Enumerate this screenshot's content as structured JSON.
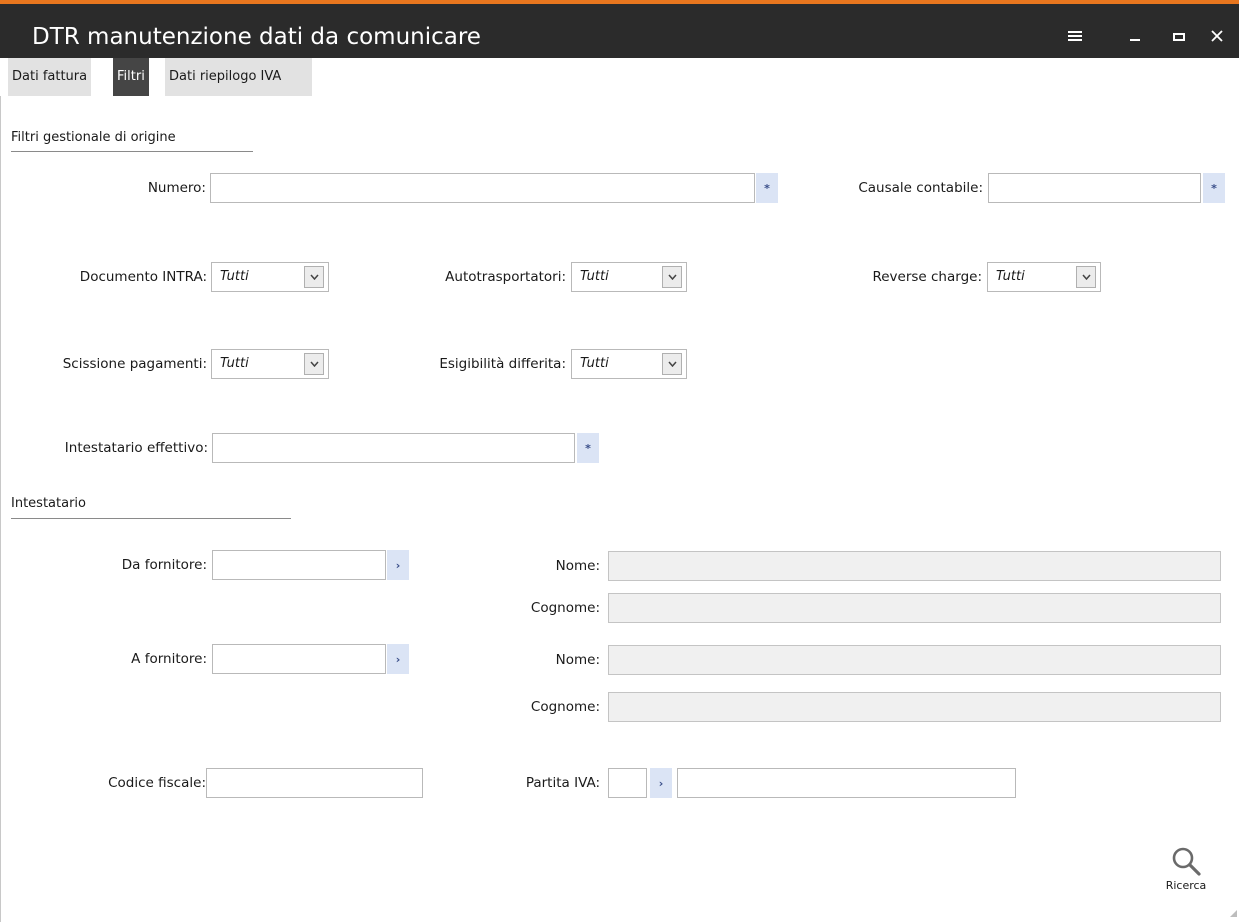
{
  "window": {
    "title": "DTR manutenzione dati da comunicare",
    "accent_color": "#e8761e",
    "titlebar_color": "#2b2b2b"
  },
  "tabs": [
    {
      "label": "Dati fattura",
      "active": false
    },
    {
      "label": "Filtri",
      "active": true
    },
    {
      "label": "Dati riepilogo IVA",
      "active": false
    }
  ],
  "filtri_gestionale": {
    "section_title": "Filtri gestionale di origine",
    "numero": {
      "label": "Numero:",
      "value": ""
    },
    "causale_contabile": {
      "label": "Causale contabile:",
      "value": ""
    },
    "documento_intra": {
      "label": "Documento INTRA:",
      "value": "Tutti"
    },
    "autotrasportatori": {
      "label": "Autotrasportatori:",
      "value": "Tutti"
    },
    "reverse_charge": {
      "label": "Reverse charge:",
      "value": "Tutti"
    },
    "scissione_pagamenti": {
      "label": "Scissione pagamenti:",
      "value": "Tutti"
    },
    "esigibilita_differita": {
      "label": "Esigibilità differita:",
      "value": "Tutti"
    },
    "intestatario_effettivo": {
      "label": "Intestatario effettivo:",
      "value": ""
    }
  },
  "intestatario": {
    "section_title": "Intestatario",
    "da_fornitore": {
      "label": "Da fornitore:",
      "value": ""
    },
    "da_nome": {
      "label": "Nome:",
      "value": ""
    },
    "da_cognome": {
      "label": "Cognome:",
      "value": ""
    },
    "a_fornitore": {
      "label": "A fornitore:",
      "value": ""
    },
    "a_nome": {
      "label": "Nome:",
      "value": ""
    },
    "a_cognome": {
      "label": "Cognome:",
      "value": ""
    },
    "codice_fiscale": {
      "label": "Codice fiscale:",
      "value": ""
    },
    "partita_iva": {
      "label": "Partita IVA:",
      "prefix_value": "",
      "value": ""
    }
  },
  "actions": {
    "search_label": "Ricerca",
    "search_icon": "magnifier-icon"
  },
  "icons": {
    "zoom_symbol": "*",
    "link_symbol": "›"
  }
}
